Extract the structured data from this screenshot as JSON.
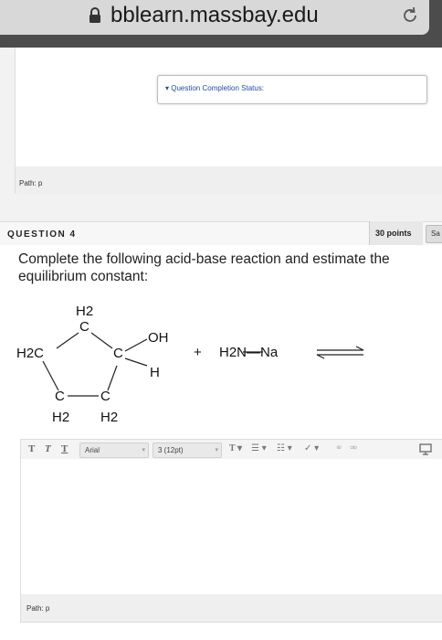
{
  "browser": {
    "domain": "bblearn.massbay.edu"
  },
  "previous_question": {
    "completion_status": "▾ Question Completion Status:",
    "path": "Path: p"
  },
  "question": {
    "number": "QUESTION 4",
    "points": "30 points",
    "save_label": "Sa",
    "text": "Complete the following acid-base reaction and estimate the equilibrium constant:"
  },
  "reaction": {
    "top_ch2": "H2",
    "top_c": "C",
    "left_ch2": "H2C",
    "right_c": "C",
    "oh": "OH",
    "h": "H",
    "bottom_left_c": "C",
    "bottom_right_c": "C",
    "bottom_left_h2": "H2",
    "bottom_right_h2": "H2",
    "plus": "+",
    "reagent": "H2N—Na"
  },
  "editor": {
    "font_family": "Arial",
    "font_size": "3 (12pt)",
    "path": "Path: p"
  },
  "colors": {
    "url_bar": "#4c4c4c",
    "link_blue": "#1b4e9e"
  }
}
